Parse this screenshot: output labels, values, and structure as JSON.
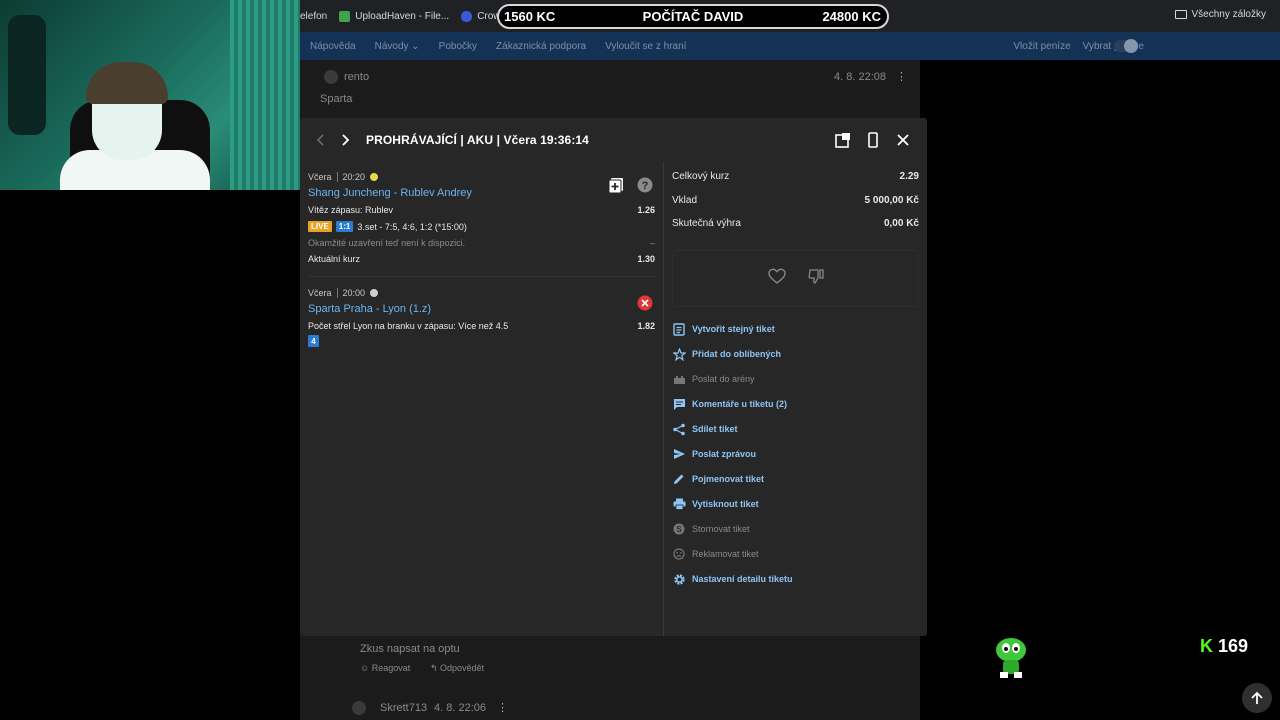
{
  "bookmarks": {
    "items": [
      {
        "label": "elefon",
        "color": ""
      },
      {
        "label": "UploadHaven - File...",
        "color": "#3fa34d"
      },
      {
        "label": "Crownspin | R",
        "color": "#3a5ad8"
      }
    ],
    "all_bookmarks": "Všechny záložky"
  },
  "score_overlay": {
    "left_value": "1560 KC",
    "name": "POČÍTAČ DAVID",
    "right_value": "24800 KC"
  },
  "site_nav": {
    "left": [
      "Nápověda",
      "Návody",
      "Pobočky",
      "Zákaznická podpora",
      "Vyloučit se z hraní"
    ],
    "right": [
      "Vložit peníze",
      "Vybrat peníze"
    ]
  },
  "background": {
    "comment1_user": "rento",
    "comment1_time": "4. 8. 22:08",
    "comment1_text": "Sparta",
    "comment2_text": "Zkus napsat na optu",
    "comment2_react": "Reagovat",
    "comment2_reply": "Odpovědět",
    "comment3_user": "Skrett713",
    "comment3_time": "4. 8. 22:06"
  },
  "modal": {
    "title": "PROHRÁVAJÍCÍ | AKU | Včera 19:36:14",
    "bets": [
      {
        "day": "Včera",
        "time": "20:20",
        "sport_color": "#e5d84a",
        "match": "Shang Juncheng - Rublev Andrey",
        "market": "Vítěz zápasu: Rublev",
        "odds": "1.26",
        "live_badge": "LIVE",
        "score_badge": "1:1",
        "live_text": "3.set - 7:5, 4:6, 1:2 (*15:00)",
        "cashout_text": "Okamžité uzavření teď není k dispozici.",
        "cashout_value": "–",
        "current_label": "Aktuální kurz",
        "current_value": "1.30",
        "status": "unknown"
      },
      {
        "day": "Včera",
        "time": "20:00",
        "sport_color": "#cfcfcf",
        "match": "Sparta Praha - Lyon (1.z)",
        "market": "Počet střel Lyon na branku v zápasu: Více než 4.5",
        "odds": "1.82",
        "num_badge": "4",
        "status": "lost"
      }
    ],
    "summary": [
      {
        "label": "Celkový kurz",
        "value": "2.29"
      },
      {
        "label": "Vklad",
        "value": "5 000,00 Kč"
      },
      {
        "label": "Skutečná výhra",
        "value": "0,00 Kč"
      }
    ],
    "actions": [
      {
        "label": "Vytvořit stejný tiket",
        "icon": "copy-ticket-icon",
        "enabled": true
      },
      {
        "label": "Přidat do oblíbených",
        "icon": "star-icon",
        "enabled": true
      },
      {
        "label": "Poslat do arény",
        "icon": "arena-icon",
        "enabled": false
      },
      {
        "label": "Komentáře u tiketu (2)",
        "icon": "comment-icon",
        "enabled": true
      },
      {
        "label": "Sdílet tiket",
        "icon": "share-icon",
        "enabled": true
      },
      {
        "label": "Poslat zprávou",
        "icon": "send-icon",
        "enabled": true
      },
      {
        "label": "Pojmenovat tiket",
        "icon": "pencil-icon",
        "enabled": true
      },
      {
        "label": "Vytisknout tiket",
        "icon": "print-icon",
        "enabled": true
      },
      {
        "label": "Stornovat tiket",
        "icon": "cancel-coin-icon",
        "enabled": false
      },
      {
        "label": "Reklamovat tiket",
        "icon": "sad-face-icon",
        "enabled": false
      },
      {
        "label": "Nastavení detailu tiketu",
        "icon": "gear-icon",
        "enabled": true
      }
    ]
  },
  "kick": {
    "logo": "K",
    "viewers": "169"
  }
}
